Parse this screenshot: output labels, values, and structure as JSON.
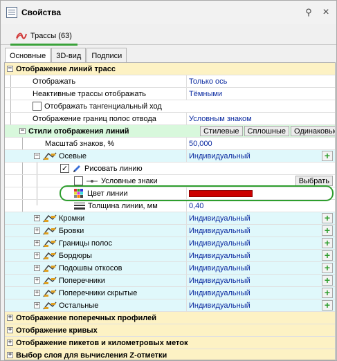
{
  "window": {
    "title": "Свойства"
  },
  "top_tab": {
    "label": "Трассы (63)"
  },
  "sub_tabs": [
    "Основные",
    "3D-вид",
    "Подписи"
  ],
  "colors": {
    "line_color": "#cc0000",
    "category_bg": "#fdf2c4",
    "subcategory_bg": "#d8f8dc",
    "highlight": "#2e9e2e",
    "value_text": "#0a2aa0"
  },
  "grid": {
    "cat_display": "Отображение линий трасс",
    "display": {
      "label": "Отображать",
      "value": "Только ось"
    },
    "inactive": {
      "label": "Неактивные трассы отображать",
      "value": "Тёмными"
    },
    "tangential": {
      "label": "Отображать тангенциальный ход"
    },
    "borders": {
      "label": "Отображение границ полос отвода",
      "value": "Условным знаком"
    },
    "styles": {
      "label": "Стили отображения линий",
      "btn_styled": "Стилевые",
      "btn_solid": "Сплошные",
      "btn_same": "Одинаковые"
    },
    "scale": {
      "label": "Масштаб знаков, %",
      "value": "50,000"
    },
    "axial": {
      "label": "Осевые",
      "value": "Индивидуальный"
    },
    "draw_line": {
      "label": "Рисовать линию"
    },
    "symbols": {
      "label": "Условные знаки",
      "button": "Выбрать"
    },
    "line_color": {
      "label": "Цвет линии"
    },
    "line_width": {
      "label": "Толщина линии, мм",
      "value": "0,40"
    },
    "items": [
      {
        "label": "Кромки",
        "value": "Индивидуальный"
      },
      {
        "label": "Бровки",
        "value": "Индивидуальный"
      },
      {
        "label": "Границы полос",
        "value": "Индивидуальный"
      },
      {
        "label": "Бордюры",
        "value": "Индивидуальный"
      },
      {
        "label": "Подошвы откосов",
        "value": "Индивидуальный"
      },
      {
        "label": "Поперечники",
        "value": "Индивидуальный"
      },
      {
        "label": "Поперечники скрытые",
        "value": "Индивидуальный"
      },
      {
        "label": "Остальные",
        "value": "Индивидуальный"
      }
    ],
    "bottom_cats": [
      "Отображение поперечных профилей",
      "Отображение кривых",
      "Отображение пикетов и километровых меток",
      "Выбор слоя для вычисления Z-отметки"
    ]
  }
}
